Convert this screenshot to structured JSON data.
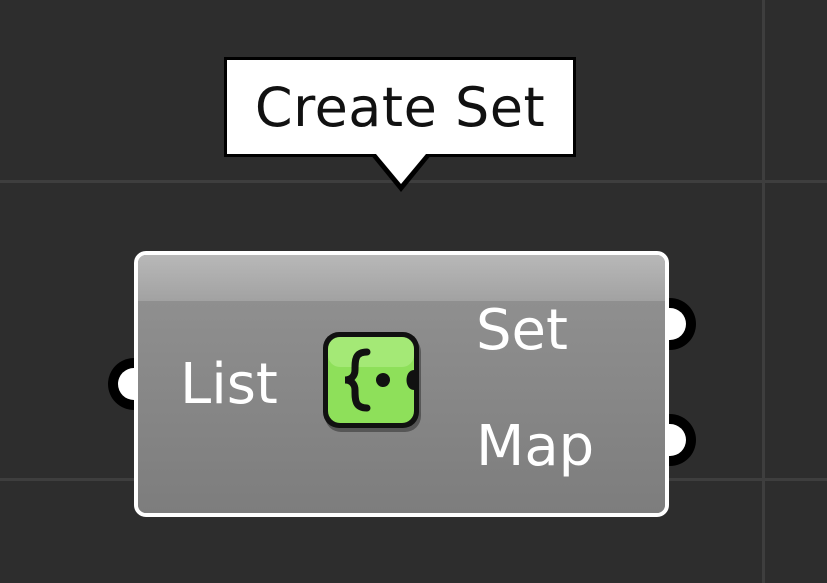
{
  "tooltip": {
    "text": "Create Set"
  },
  "component": {
    "name": "Create Set",
    "icon": "create-set-icon",
    "inputs": [
      {
        "label": "List"
      }
    ],
    "outputs": [
      {
        "label": "Set"
      },
      {
        "label": "Map"
      }
    ]
  },
  "colors": {
    "canvas": "#2d2d2d",
    "grid_line": "#3e3e3e",
    "component_fill": "#8a8a8a",
    "component_border": "#ffffff",
    "icon_green": "#8ee05a",
    "tooltip_fill": "#ffffff"
  }
}
